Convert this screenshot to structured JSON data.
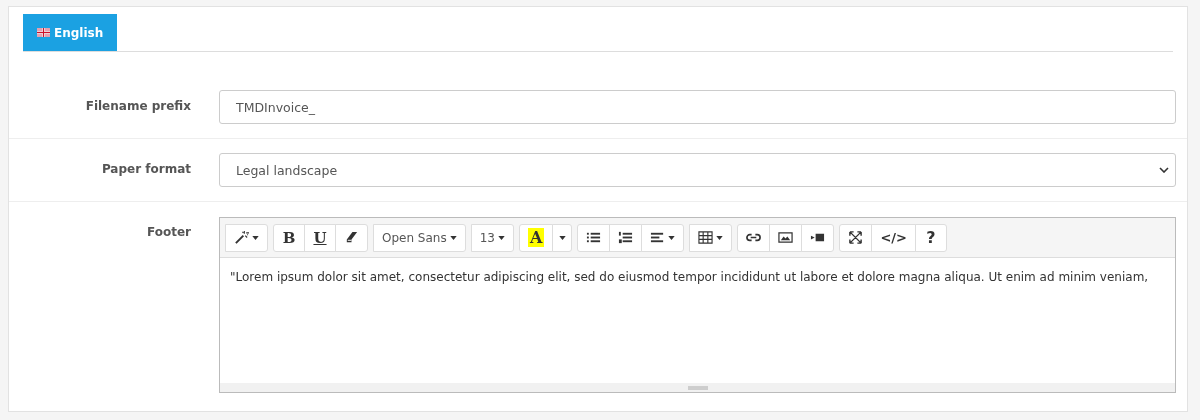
{
  "tabs": [
    {
      "label": "English",
      "selected": true
    }
  ],
  "fields": [
    {
      "kind": "input",
      "label": "Filename prefix",
      "value": "TMDInvoice_"
    },
    {
      "kind": "select",
      "label": "Paper format",
      "value": "Legal landscape"
    },
    {
      "kind": "editor",
      "label": "Footer",
      "text": "\"Lorem ipsum dolor sit amet, consectetur adipiscing elit, sed do eiusmod tempor incididunt ut labore et dolore magna aliqua. Ut enim ad minim veniam,"
    }
  ],
  "toolbar": [
    [
      {
        "kind": "magic",
        "caret": true
      }
    ],
    [
      {
        "kind": "text",
        "label": "B",
        "caret": false
      },
      {
        "kind": "text",
        "label": "U",
        "caret": false
      },
      {
        "kind": "eraser",
        "caret": false
      }
    ],
    [
      {
        "kind": "text",
        "label": "Open Sans",
        "caret": true
      }
    ],
    [
      {
        "kind": "text",
        "label": "13",
        "caret": true
      }
    ],
    [
      {
        "kind": "highlight",
        "label": "A",
        "caret": false
      },
      {
        "kind": "caret",
        "caret": false
      }
    ],
    [
      {
        "kind": "ul",
        "caret": false
      },
      {
        "kind": "ol",
        "caret": false
      },
      {
        "kind": "align",
        "caret": true
      }
    ],
    [
      {
        "kind": "table",
        "caret": true
      }
    ],
    [
      {
        "kind": "link",
        "caret": false
      },
      {
        "kind": "image",
        "caret": false
      },
      {
        "kind": "video",
        "caret": false
      }
    ],
    [
      {
        "kind": "fullscreen",
        "caret": false
      },
      {
        "kind": "text",
        "label": "</>",
        "caret": false
      },
      {
        "kind": "text",
        "label": "?",
        "caret": false
      }
    ]
  ]
}
